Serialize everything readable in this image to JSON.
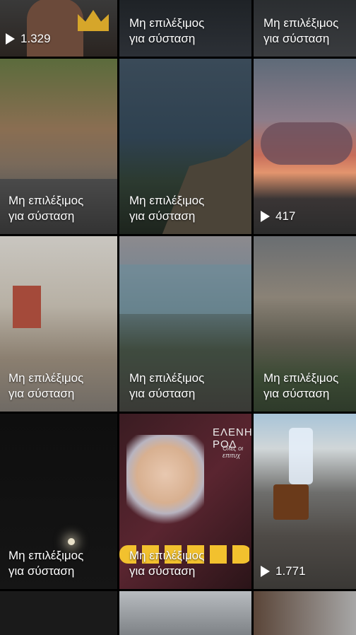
{
  "tiles": [
    {
      "caption": "",
      "views": "1.329"
    },
    {
      "caption": "Μη επιλέξιμος\nγια σύσταση",
      "views": ""
    },
    {
      "caption": "Μη επιλέξιμος\nγια σύσταση",
      "views": ""
    },
    {
      "caption": "Μη επιλέξιμος\nγια σύσταση",
      "views": ""
    },
    {
      "caption": "Μη επιλέξιμος\nγια σύσταση",
      "views": ""
    },
    {
      "caption": "",
      "views": "417"
    },
    {
      "caption": "Μη επιλέξιμος\nγια σύσταση",
      "views": ""
    },
    {
      "caption": "Μη επιλέξιμος\nγια σύσταση",
      "views": ""
    },
    {
      "caption": "Μη επιλέξιμος\nγια σύσταση",
      "views": ""
    },
    {
      "caption": "Μη επιλέξιμος\nγια σύσταση",
      "views": ""
    },
    {
      "caption": "Μη επιλέξιμος\nγια σύσταση",
      "views": "",
      "overlay_text": "ΕΛΕΝΗ ΡΟΔ",
      "overlay_subtext": "Όλες οι επιτυχ"
    },
    {
      "caption": "",
      "views": "1.771"
    }
  ]
}
